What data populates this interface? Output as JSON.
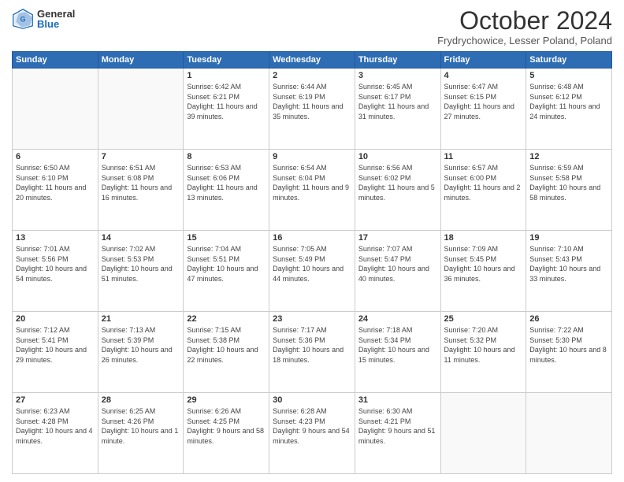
{
  "header": {
    "logo_general": "General",
    "logo_blue": "Blue",
    "month_title": "October 2024",
    "location": "Frydrychowice, Lesser Poland, Poland"
  },
  "days_of_week": [
    "Sunday",
    "Monday",
    "Tuesday",
    "Wednesday",
    "Thursday",
    "Friday",
    "Saturday"
  ],
  "weeks": [
    [
      {
        "day": "",
        "info": ""
      },
      {
        "day": "",
        "info": ""
      },
      {
        "day": "1",
        "info": "Sunrise: 6:42 AM\nSunset: 6:21 PM\nDaylight: 11 hours and 39 minutes."
      },
      {
        "day": "2",
        "info": "Sunrise: 6:44 AM\nSunset: 6:19 PM\nDaylight: 11 hours and 35 minutes."
      },
      {
        "day": "3",
        "info": "Sunrise: 6:45 AM\nSunset: 6:17 PM\nDaylight: 11 hours and 31 minutes."
      },
      {
        "day": "4",
        "info": "Sunrise: 6:47 AM\nSunset: 6:15 PM\nDaylight: 11 hours and 27 minutes."
      },
      {
        "day": "5",
        "info": "Sunrise: 6:48 AM\nSunset: 6:12 PM\nDaylight: 11 hours and 24 minutes."
      }
    ],
    [
      {
        "day": "6",
        "info": "Sunrise: 6:50 AM\nSunset: 6:10 PM\nDaylight: 11 hours and 20 minutes."
      },
      {
        "day": "7",
        "info": "Sunrise: 6:51 AM\nSunset: 6:08 PM\nDaylight: 11 hours and 16 minutes."
      },
      {
        "day": "8",
        "info": "Sunrise: 6:53 AM\nSunset: 6:06 PM\nDaylight: 11 hours and 13 minutes."
      },
      {
        "day": "9",
        "info": "Sunrise: 6:54 AM\nSunset: 6:04 PM\nDaylight: 11 hours and 9 minutes."
      },
      {
        "day": "10",
        "info": "Sunrise: 6:56 AM\nSunset: 6:02 PM\nDaylight: 11 hours and 5 minutes."
      },
      {
        "day": "11",
        "info": "Sunrise: 6:57 AM\nSunset: 6:00 PM\nDaylight: 11 hours and 2 minutes."
      },
      {
        "day": "12",
        "info": "Sunrise: 6:59 AM\nSunset: 5:58 PM\nDaylight: 10 hours and 58 minutes."
      }
    ],
    [
      {
        "day": "13",
        "info": "Sunrise: 7:01 AM\nSunset: 5:56 PM\nDaylight: 10 hours and 54 minutes."
      },
      {
        "day": "14",
        "info": "Sunrise: 7:02 AM\nSunset: 5:53 PM\nDaylight: 10 hours and 51 minutes."
      },
      {
        "day": "15",
        "info": "Sunrise: 7:04 AM\nSunset: 5:51 PM\nDaylight: 10 hours and 47 minutes."
      },
      {
        "day": "16",
        "info": "Sunrise: 7:05 AM\nSunset: 5:49 PM\nDaylight: 10 hours and 44 minutes."
      },
      {
        "day": "17",
        "info": "Sunrise: 7:07 AM\nSunset: 5:47 PM\nDaylight: 10 hours and 40 minutes."
      },
      {
        "day": "18",
        "info": "Sunrise: 7:09 AM\nSunset: 5:45 PM\nDaylight: 10 hours and 36 minutes."
      },
      {
        "day": "19",
        "info": "Sunrise: 7:10 AM\nSunset: 5:43 PM\nDaylight: 10 hours and 33 minutes."
      }
    ],
    [
      {
        "day": "20",
        "info": "Sunrise: 7:12 AM\nSunset: 5:41 PM\nDaylight: 10 hours and 29 minutes."
      },
      {
        "day": "21",
        "info": "Sunrise: 7:13 AM\nSunset: 5:39 PM\nDaylight: 10 hours and 26 minutes."
      },
      {
        "day": "22",
        "info": "Sunrise: 7:15 AM\nSunset: 5:38 PM\nDaylight: 10 hours and 22 minutes."
      },
      {
        "day": "23",
        "info": "Sunrise: 7:17 AM\nSunset: 5:36 PM\nDaylight: 10 hours and 18 minutes."
      },
      {
        "day": "24",
        "info": "Sunrise: 7:18 AM\nSunset: 5:34 PM\nDaylight: 10 hours and 15 minutes."
      },
      {
        "day": "25",
        "info": "Sunrise: 7:20 AM\nSunset: 5:32 PM\nDaylight: 10 hours and 11 minutes."
      },
      {
        "day": "26",
        "info": "Sunrise: 7:22 AM\nSunset: 5:30 PM\nDaylight: 10 hours and 8 minutes."
      }
    ],
    [
      {
        "day": "27",
        "info": "Sunrise: 6:23 AM\nSunset: 4:28 PM\nDaylight: 10 hours and 4 minutes."
      },
      {
        "day": "28",
        "info": "Sunrise: 6:25 AM\nSunset: 4:26 PM\nDaylight: 10 hours and 1 minute."
      },
      {
        "day": "29",
        "info": "Sunrise: 6:26 AM\nSunset: 4:25 PM\nDaylight: 9 hours and 58 minutes."
      },
      {
        "day": "30",
        "info": "Sunrise: 6:28 AM\nSunset: 4:23 PM\nDaylight: 9 hours and 54 minutes."
      },
      {
        "day": "31",
        "info": "Sunrise: 6:30 AM\nSunset: 4:21 PM\nDaylight: 9 hours and 51 minutes."
      },
      {
        "day": "",
        "info": ""
      },
      {
        "day": "",
        "info": ""
      }
    ]
  ]
}
